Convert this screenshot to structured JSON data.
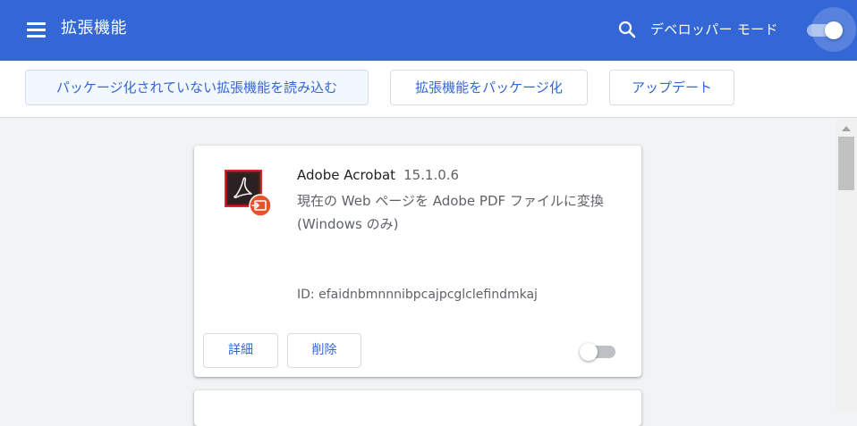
{
  "header": {
    "title": "拡張機能",
    "menu_icon": "hamburger-menu-icon",
    "search_icon": "search-icon",
    "developer_mode_label": "デベロッパー モード",
    "developer_mode_on": true,
    "background_color": "#3367d6"
  },
  "toolbar": {
    "load_unpacked_label": "パッケージ化されていない拡張機能を読み込む",
    "pack_extension_label": "拡張機能をパッケージ化",
    "update_label": "アップデート",
    "button_text_color": "#3367d6"
  },
  "extensions": [
    {
      "icon": "adobe-acrobat-icon",
      "name": "Adobe Acrobat",
      "version": "15.1.0.6",
      "description": "現在の Web ページを Adobe PDF ファイルに変換 (Windows のみ)",
      "id_text": "ID: efaidnbmnnnibpcajpcglclefindmkaj",
      "details_label": "詳細",
      "remove_label": "削除",
      "enabled": false
    }
  ]
}
